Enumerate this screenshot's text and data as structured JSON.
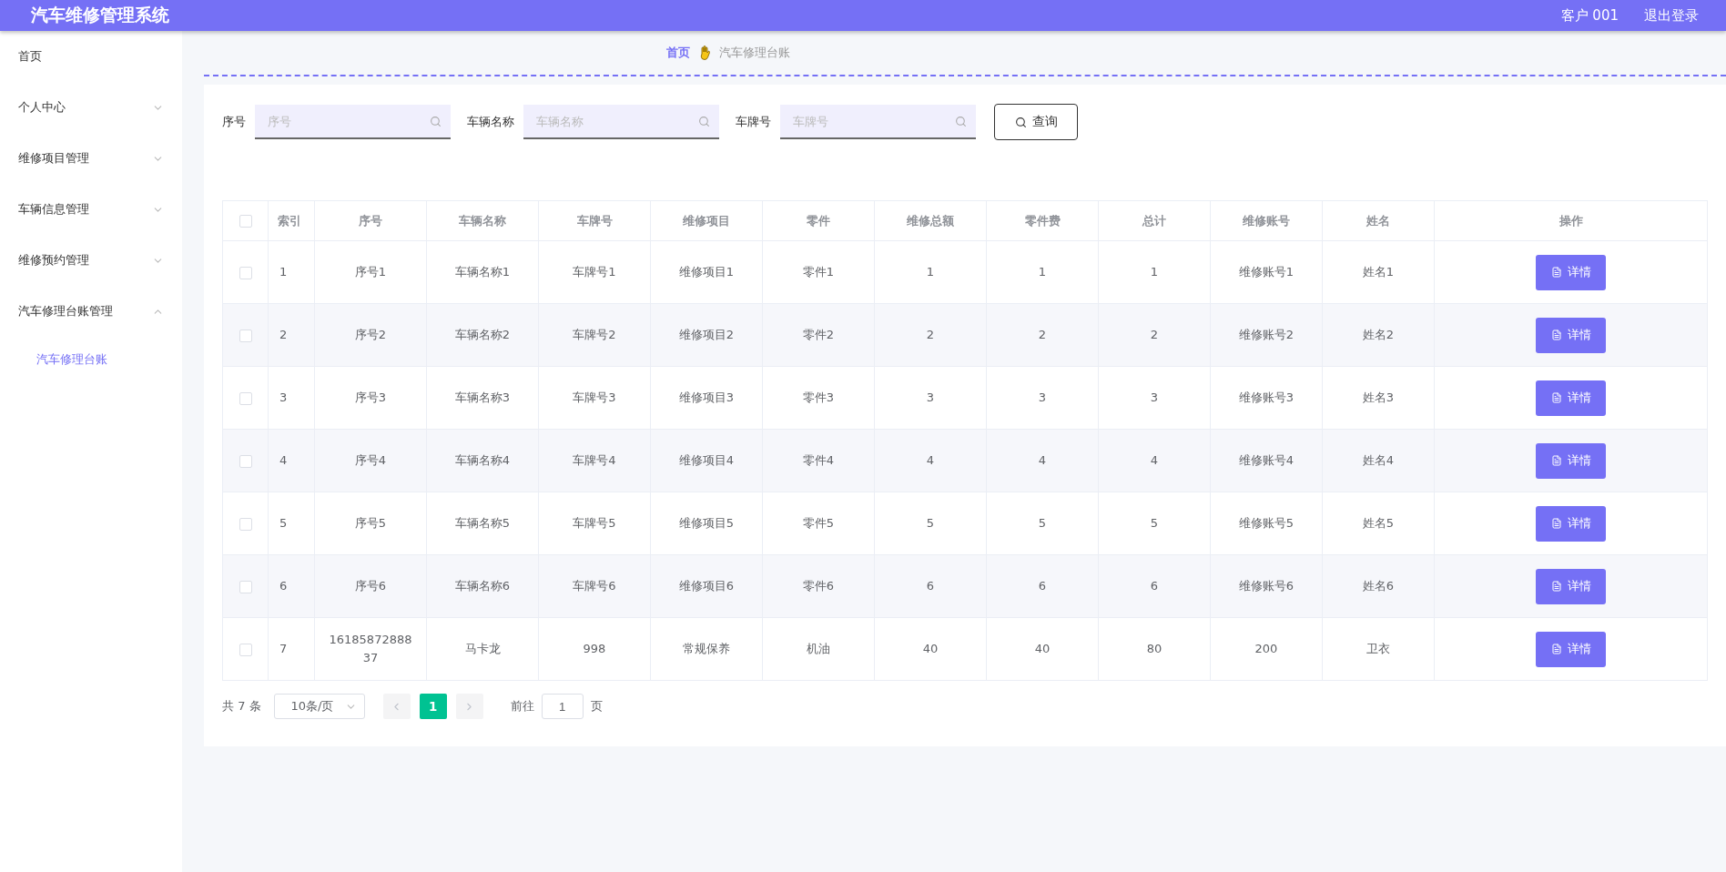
{
  "header": {
    "title": "汽车维修管理系统",
    "user": "客户 001",
    "logout": "退出登录"
  },
  "sidebar": {
    "items": [
      {
        "kind": "link",
        "label": "首页"
      },
      {
        "kind": "submenu",
        "label": "个人中心",
        "expanded": false
      },
      {
        "kind": "submenu",
        "label": "维修项目管理",
        "expanded": false
      },
      {
        "kind": "submenu",
        "label": "车辆信息管理",
        "expanded": false
      },
      {
        "kind": "submenu",
        "label": "维修预约管理",
        "expanded": false
      },
      {
        "kind": "submenu",
        "label": "汽车修理台账管理",
        "expanded": true,
        "children": [
          {
            "label": "汽车修理台账",
            "selected": true
          }
        ]
      }
    ]
  },
  "breadcrumb": [
    "首页",
    "汽车修理台账"
  ],
  "filters": [
    {
      "label": "序号",
      "placeholder": "序号"
    },
    {
      "label": "车辆名称",
      "placeholder": "车辆名称"
    },
    {
      "label": "车牌号",
      "placeholder": "车牌号"
    }
  ],
  "search_button": "查询",
  "table": {
    "all_checked": false,
    "columns": [
      "索引",
      "序号",
      "车辆名称",
      "车牌号",
      "维修项目",
      "零件",
      "维修总额",
      "零件费",
      "总计",
      "维修账号",
      "姓名",
      "操作"
    ],
    "rows": [
      {
        "checked": false,
        "cells": [
          "1",
          "序号1",
          "车辆名称1",
          "车牌号1",
          "维修项目1",
          "零件1",
          "1",
          "1",
          "1",
          "维修账号1",
          "姓名1"
        ],
        "action": "详情"
      },
      {
        "checked": false,
        "cells": [
          "2",
          "序号2",
          "车辆名称2",
          "车牌号2",
          "维修项目2",
          "零件2",
          "2",
          "2",
          "2",
          "维修账号2",
          "姓名2"
        ],
        "action": "详情"
      },
      {
        "checked": false,
        "cells": [
          "3",
          "序号3",
          "车辆名称3",
          "车牌号3",
          "维修项目3",
          "零件3",
          "3",
          "3",
          "3",
          "维修账号3",
          "姓名3"
        ],
        "action": "详情"
      },
      {
        "checked": false,
        "cells": [
          "4",
          "序号4",
          "车辆名称4",
          "车牌号4",
          "维修项目4",
          "零件4",
          "4",
          "4",
          "4",
          "维修账号4",
          "姓名4"
        ],
        "action": "详情"
      },
      {
        "checked": false,
        "cells": [
          "5",
          "序号5",
          "车辆名称5",
          "车牌号5",
          "维修项目5",
          "零件5",
          "5",
          "5",
          "5",
          "维修账号5",
          "姓名5"
        ],
        "action": "详情"
      },
      {
        "checked": false,
        "cells": [
          "6",
          "序号6",
          "车辆名称6",
          "车牌号6",
          "维修项目6",
          "零件6",
          "6",
          "6",
          "6",
          "维修账号6",
          "姓名6"
        ],
        "action": "详情"
      },
      {
        "checked": false,
        "cells": [
          "7",
          "1618587288837",
          "马卡龙",
          "998",
          "常规保养",
          "机油",
          "40",
          "40",
          "80",
          "200",
          "卫衣"
        ],
        "action": "详情"
      }
    ]
  },
  "pagination": {
    "total": "共 7 条",
    "page_size": "10条/页",
    "pages": [
      {
        "label": "1",
        "selected": true
      }
    ],
    "goto_label": "前往",
    "goto_value": "1",
    "goto_suffix": "页"
  }
}
